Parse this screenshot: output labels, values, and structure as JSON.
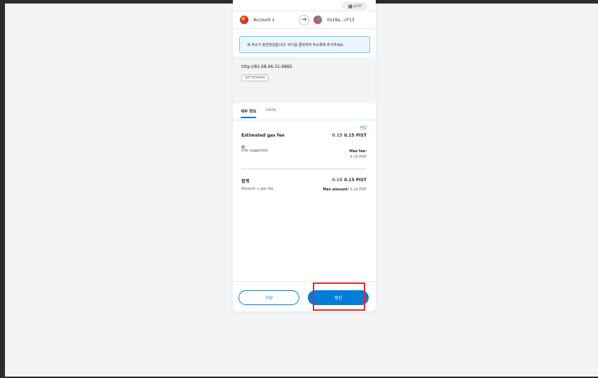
{
  "network": {
    "label": "pist",
    "icon": "question-icon"
  },
  "accounts": {
    "from": "Account 1",
    "to": "0x19a...cF13"
  },
  "notice": "새 주소가 발견되었습니다! 여기를 클릭하여 주소록에 추가하세요.",
  "origin": {
    "url": "http://81.68.96.31:9885",
    "method": "WITHDRAW"
  },
  "tabs": [
    "세부 정보",
    "DATA"
  ],
  "details": {
    "edit_label": "편집",
    "gas_label": "Estimated gas fee",
    "gas_value_plain": "0.15",
    "gas_value_bold": "0.15 PIST",
    "site_suggested": "Site suggested",
    "max_fee_label": "Max fee:",
    "max_fee_value": "0.15 PIST",
    "total_label": "합계",
    "total_value_plain": "0.15",
    "total_value_bold": "0.15 PIST",
    "amount_gas_label": "Amount + gas fee",
    "max_amount_label": "Max amount:",
    "max_amount_value": "0.15 PIST"
  },
  "footer": {
    "reject_label": "거부",
    "confirm_label": "확인"
  },
  "colors": {
    "accent": "#037dd6",
    "highlight": "#e8262b",
    "notice_bg": "#eaf6ff"
  }
}
